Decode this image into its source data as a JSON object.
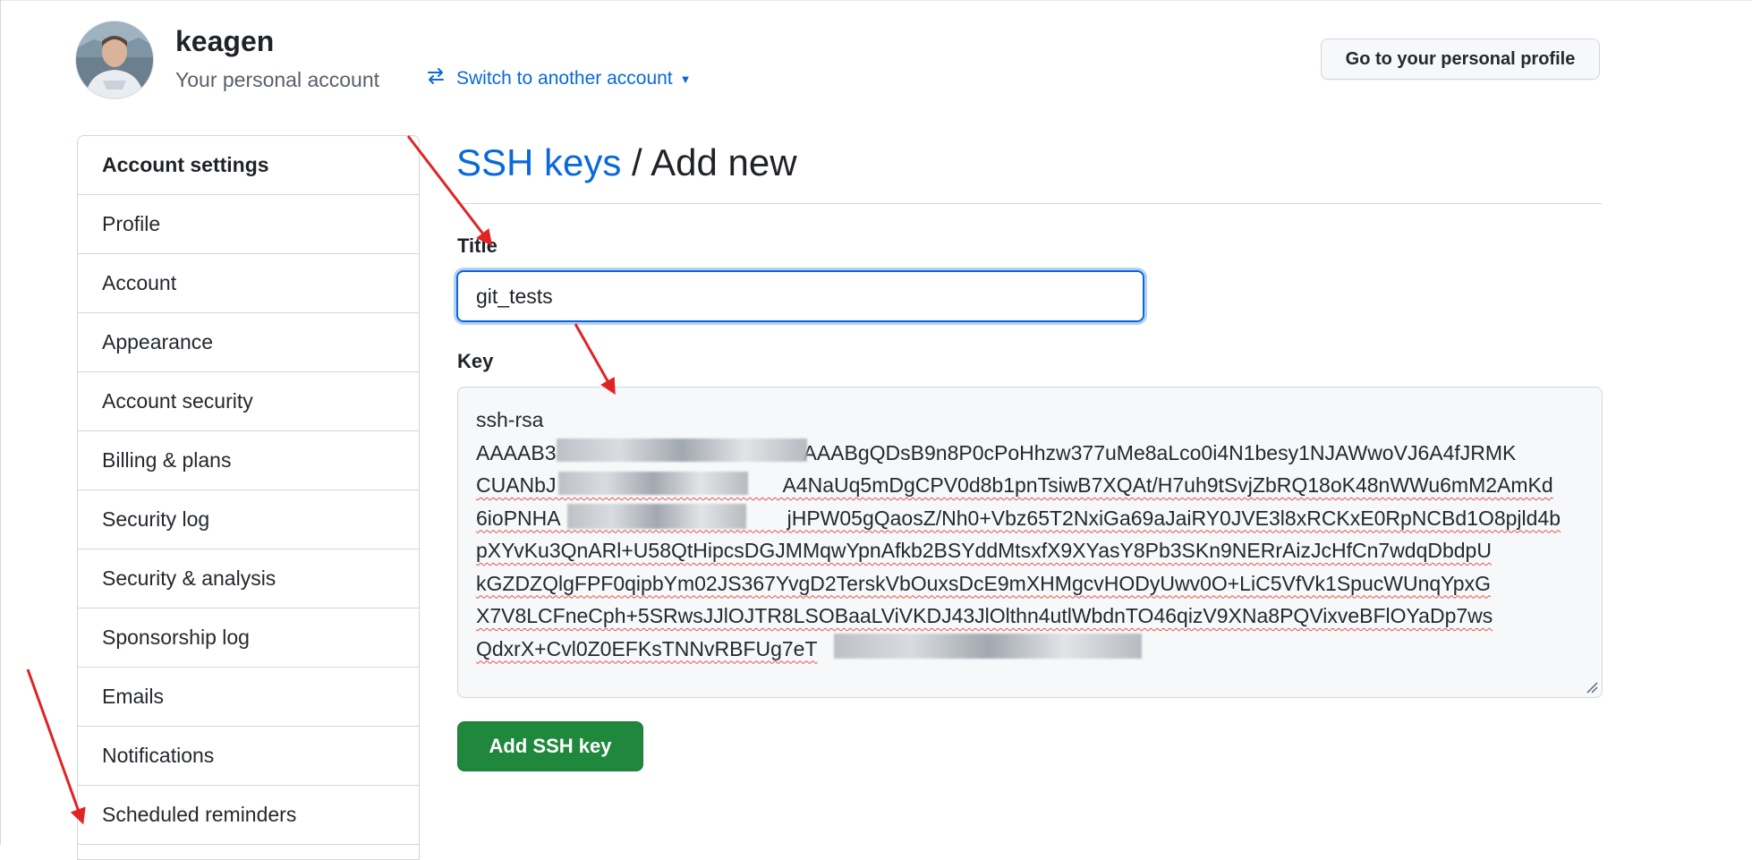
{
  "header": {
    "username": "keagen",
    "account_subtitle": "Your personal account",
    "switch_label": "Switch to another account",
    "profile_button": "Go to your personal profile"
  },
  "sidebar": {
    "items": [
      {
        "label": "Account settings",
        "header": true
      },
      {
        "label": "Profile"
      },
      {
        "label": "Account"
      },
      {
        "label": "Appearance"
      },
      {
        "label": "Account security"
      },
      {
        "label": "Billing & plans"
      },
      {
        "label": "Security log"
      },
      {
        "label": "Security & analysis"
      },
      {
        "label": "Sponsorship log"
      },
      {
        "label": "Emails"
      },
      {
        "label": "Notifications"
      },
      {
        "label": "Scheduled reminders"
      }
    ]
  },
  "main": {
    "breadcrumb_link": "SSH keys",
    "breadcrumb_rest": " / Add new",
    "title_label": "Title",
    "title_value": "git_tests",
    "key_label": "Key",
    "key_lines": [
      "ssh-rsa",
      "AAAAB3            AAABgQDsB9n8P0cPoHhzw377uMe8aLco0i4N1besy1NJAWwoVJ6A4fJRMK",
      "CUANbJ           A4NaUq5mDgCPV0d8b1pnTsiwB7XQAt/H7uh9tSvjZbRQ18oK48nWWu6mM2AmKd",
      "6ioPNHA           jHPW05gQaosZ/Nh0+Vbz65T2NxiGa69aJaiRY0JVE3l8xRCKxE0RpNCBd1O8pjld4b",
      "pXYvKu3QnARl+U58QtHipcsDGJMMqwYpnAfkb2BSYddMtsxfX9XYasY8Pb3SKn9NERrAizJcHfCn7wdqDbdpU",
      "kGZDZQlgFPF0qipbYm02JS367YvgD2TerskVbOuxsDcE9mXHMgcvHODyUwv0O+LiC5VfVk1SpucWUnqYpxG",
      "X7V8LCFneCph+5SRwsJJlOJTR8LSOBaaLViVKDJ43JlOlthn4utlWbdnTO46qizV9XNa8PQVixveBFlOYaDp7ws",
      "QdxrX+Cvl0Z0EFKsTNNvRBFUg7eT"
    ],
    "submit_button": "Add SSH key"
  },
  "colors": {
    "accent": "#0969da",
    "primary_button": "#1f883d",
    "annotation_arrow": "#e02424"
  }
}
